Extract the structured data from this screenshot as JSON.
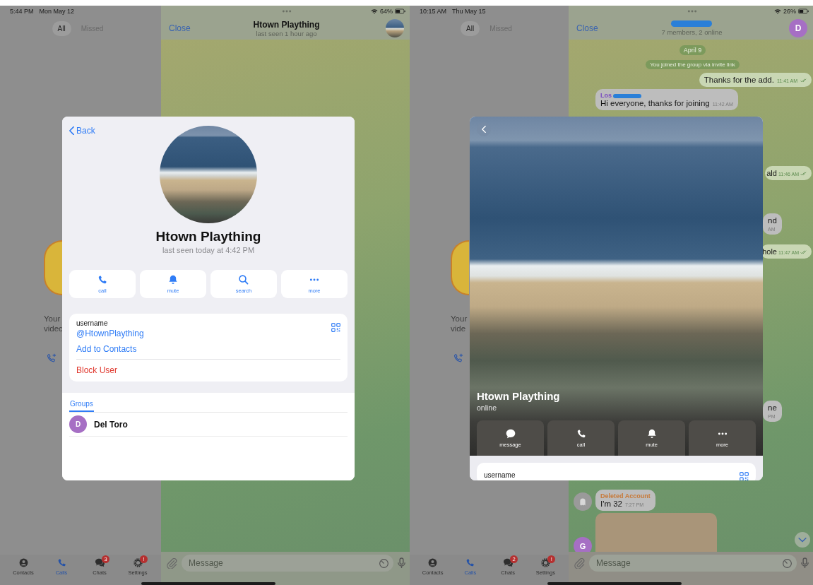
{
  "screens": [
    {
      "status_bar": {
        "time": "5:44 PM",
        "date": "Mon May 12",
        "battery": "64%"
      },
      "sidebar": {
        "filters": [
          {
            "label": "All",
            "selected": true
          },
          {
            "label": "Missed",
            "selected": false
          }
        ],
        "empty_texts": [
          "Your",
          "videc"
        ],
        "tabs": [
          {
            "label": "Contacts",
            "selected": false
          },
          {
            "label": "Calls",
            "selected": true
          },
          {
            "label": "Chats",
            "selected": false,
            "badge": "3"
          },
          {
            "label": "Settings",
            "selected": false,
            "badge": "!"
          }
        ]
      },
      "chat": {
        "close": "Close",
        "title": "Htown Plaything",
        "title_redacted": false,
        "subtitle": "last seen 1 hour ago",
        "avatar": {
          "kind": "photo"
        },
        "composer": {
          "placeholder": "Message"
        }
      },
      "profile": {
        "kind": "card",
        "back": "Back",
        "name": "Htown Plaything",
        "status": "last seen today at 4:42 PM",
        "actions": [
          {
            "kind": "call",
            "label": "call"
          },
          {
            "kind": "mute",
            "label": "mute"
          },
          {
            "kind": "search",
            "label": "search"
          },
          {
            "kind": "more",
            "label": "more"
          }
        ],
        "info": {
          "username_label": "username",
          "username": "@HtownPlaything",
          "add_contact": "Add to Contacts",
          "block": "Block User"
        },
        "groups_tab": {
          "label": "Groups",
          "selected": true
        },
        "groups": [
          {
            "letter": "D",
            "name": "Del Toro"
          }
        ]
      }
    },
    {
      "status_bar": {
        "time": "10:15 AM",
        "date": "Thu May 15",
        "battery": "26%"
      },
      "sidebar": {
        "filters": [
          {
            "label": "All",
            "selected": true
          },
          {
            "label": "Missed",
            "selected": false
          }
        ],
        "empty_texts": [
          "Your",
          "vide"
        ],
        "tabs": [
          {
            "label": "Contacts",
            "selected": false
          },
          {
            "label": "Calls",
            "selected": true
          },
          {
            "label": "Chats",
            "selected": false,
            "badge": "2"
          },
          {
            "label": "Settings",
            "selected": false,
            "badge": "!"
          }
        ]
      },
      "chat": {
        "close": "Close",
        "title_redacted": true,
        "subtitle": "7 members, 2 online",
        "avatar": {
          "kind": "letter",
          "letter": "D"
        },
        "composer": {
          "placeholder": "Message"
        },
        "messages": [
          {
            "kind": "date",
            "text": "April 9"
          },
          {
            "kind": "service",
            "text": "You joined the group via invite link"
          },
          {
            "kind": "out",
            "text": "Thanks for the add.",
            "time": "11:41 AM",
            "read": true
          },
          {
            "kind": "in",
            "sender": "Los",
            "sender_redacted": true,
            "text": "Hi everyone, thanks for joining",
            "time": "11:42 AM"
          },
          {
            "kind": "out",
            "partial": true,
            "text": "ald",
            "time": "11:46 AM",
            "read": true
          },
          {
            "kind": "in",
            "partial": true,
            "text": "nd",
            "time": "AM"
          },
          {
            "kind": "out",
            "partial": true,
            "text": "hole",
            "time": "11:47 AM",
            "read": true
          },
          {
            "kind": "in",
            "partial": true,
            "text": "ne",
            "time": "PM"
          },
          {
            "kind": "in",
            "sender": "Deleted Account",
            "text": "I'm 32",
            "time": "7:27 PM",
            "avatar": {
              "kind": "ghost"
            }
          },
          {
            "kind": "photo",
            "avatar": {
              "kind": "letter",
              "letter": "G"
            }
          }
        ]
      },
      "profile": {
        "kind": "cover",
        "name": "Htown Plaything",
        "status": "online",
        "actions": [
          {
            "kind": "message",
            "label": "message"
          },
          {
            "kind": "call",
            "label": "call"
          },
          {
            "kind": "mute",
            "label": "mute"
          },
          {
            "kind": "more",
            "label": "more"
          }
        ],
        "info": {
          "username_label": "username"
        }
      }
    }
  ]
}
